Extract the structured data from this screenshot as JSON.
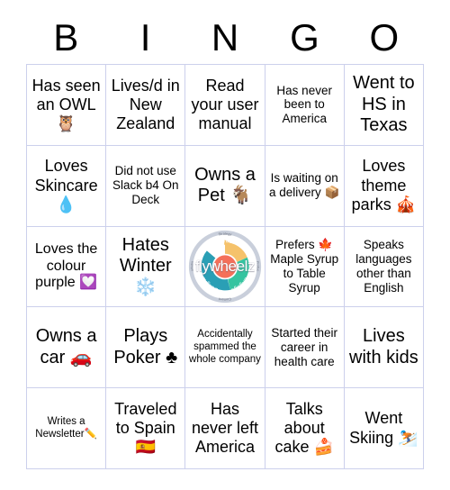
{
  "card": {
    "header_letters": [
      "B",
      "I",
      "N",
      "G",
      "O"
    ]
  },
  "colors": {
    "grid_border": "#ccd0ec",
    "background": "#ffffff",
    "text": "#000000",
    "logo_attract": "#f5c26b",
    "logo_engage": "#35c4a0",
    "logo_delight": "#2a9fb5",
    "logo_hub": "#f4705a",
    "logo_outer_ring": "#c9cfdb",
    "logo_inner_ring": "#d9dee7"
  },
  "logo": {
    "name": "flywheel-logo",
    "wordmark": "flywheelz",
    "segments": [
      "Attract",
      "Engage",
      "Delight"
    ],
    "outer_labels": [
      "Strategy",
      "Product",
      "Content",
      "Marketing"
    ]
  },
  "squares": [
    {
      "row": 1,
      "col": 1,
      "text": "Has seen an OWL 🦉",
      "size": "lg"
    },
    {
      "row": 1,
      "col": 2,
      "text": "Lives/d in New Zealand",
      "size": "lg"
    },
    {
      "row": 1,
      "col": 3,
      "text": "Read your user manual",
      "size": "lg"
    },
    {
      "row": 1,
      "col": 4,
      "text": "Has never been to America",
      "size": "sm"
    },
    {
      "row": 1,
      "col": 5,
      "text": "Went to HS in Texas",
      "size": "xl"
    },
    {
      "row": 2,
      "col": 1,
      "text": "Loves Skincare 💧",
      "size": "lg"
    },
    {
      "row": 2,
      "col": 2,
      "text": "Did not use Slack b4 On Deck",
      "size": "sm"
    },
    {
      "row": 2,
      "col": 3,
      "text": "Owns a Pet 🐐",
      "size": "xl"
    },
    {
      "row": 2,
      "col": 4,
      "text": "Is waiting on a delivery 📦",
      "size": "sm"
    },
    {
      "row": 2,
      "col": 5,
      "text": "Loves theme parks 🎪",
      "size": "lg"
    },
    {
      "row": 3,
      "col": 1,
      "text": "Loves the colour purple 💟",
      "size": "md"
    },
    {
      "row": 3,
      "col": 2,
      "text": "Hates Winter ❄️",
      "size": "xl"
    },
    {
      "row": 3,
      "col": 3,
      "text": "",
      "size": "logo"
    },
    {
      "row": 3,
      "col": 4,
      "text": "Prefers 🍁 Maple Syrup to Table Syrup",
      "size": "sm"
    },
    {
      "row": 3,
      "col": 5,
      "text": "Speaks languages other than English",
      "size": "sm"
    },
    {
      "row": 4,
      "col": 1,
      "text": "Owns a car 🚗",
      "size": "xl"
    },
    {
      "row": 4,
      "col": 2,
      "text": "Plays Poker ♣",
      "size": "xl"
    },
    {
      "row": 4,
      "col": 3,
      "text": "Accidentally spammed the whole company",
      "size": "xs"
    },
    {
      "row": 4,
      "col": 4,
      "text": "Started their career in health care",
      "size": "sm"
    },
    {
      "row": 4,
      "col": 5,
      "text": "Lives with kids",
      "size": "xl"
    },
    {
      "row": 5,
      "col": 1,
      "text": "Writes a Newsletter✏️",
      "size": "xs"
    },
    {
      "row": 5,
      "col": 2,
      "text": "Traveled to Spain 🇪🇸",
      "size": "lg"
    },
    {
      "row": 5,
      "col": 3,
      "text": "Has never left America",
      "size": "lg"
    },
    {
      "row": 5,
      "col": 4,
      "text": "Talks about cake 🍰",
      "size": "lg"
    },
    {
      "row": 5,
      "col": 5,
      "text": "Went Skiing ⛷️",
      "size": "lg"
    }
  ]
}
